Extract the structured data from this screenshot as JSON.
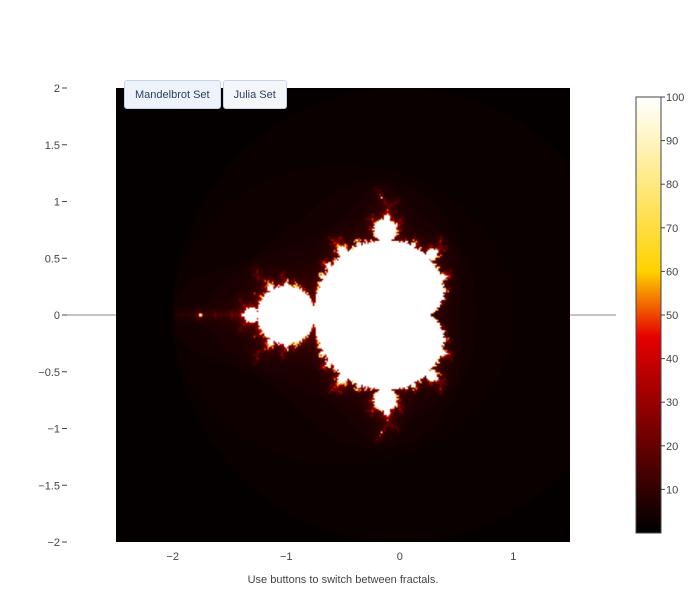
{
  "buttons": [
    {
      "label": "Mandelbrot Set"
    },
    {
      "label": "Julia Set"
    }
  ],
  "caption": "Use buttons to switch between fractals.",
  "chart_data": {
    "type": "heatmap",
    "title": "",
    "xlabel": "",
    "ylabel": "",
    "xlim": [
      -2.5,
      1.5
    ],
    "ylim": [
      -2,
      2
    ],
    "x_ticks": [
      -2,
      -1,
      0,
      1
    ],
    "y_ticks": [
      -2,
      -1.5,
      -1,
      -0.5,
      0,
      0.5,
      1,
      1.5,
      2
    ],
    "x_tick_labels": [
      "−2",
      "−1",
      "0",
      "1"
    ],
    "y_tick_labels": [
      "−2",
      "−1.5",
      "−1",
      "−0.5",
      "0",
      "0.5",
      "1",
      "1.5",
      "2"
    ],
    "fractal": "mandelbrot",
    "max_iterations": 100,
    "colorscale": "Hot",
    "colorbar": {
      "min": 0,
      "max": 100,
      "ticks": [
        10,
        20,
        30,
        40,
        50,
        60,
        70,
        80,
        90,
        100
      ],
      "tick_labels": [
        "10",
        "20",
        "30",
        "40",
        "50",
        "60",
        "70",
        "80",
        "90",
        "100"
      ]
    },
    "zero_line": {
      "y": 0,
      "color": "#888888"
    },
    "colors": {
      "scale": [
        "#000000",
        "#e60000",
        "#ffd200",
        "#ffffff"
      ],
      "axis_text": "#444444"
    }
  }
}
